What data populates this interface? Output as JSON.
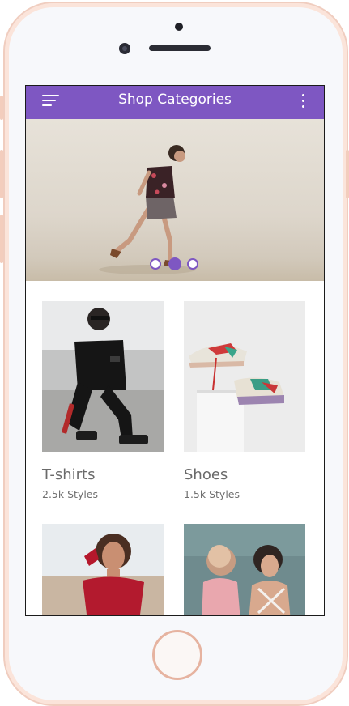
{
  "app": {
    "title": "Shop Categories",
    "accent_color": "#7e57c2",
    "menu_icon": "menu-icon",
    "more_icon": "more-vert-icon"
  },
  "carousel": {
    "slide_count": 3,
    "active_index": 1
  },
  "categories": [
    {
      "name": "T-shirts",
      "styles": "2.5k Styles"
    },
    {
      "name": "Shoes",
      "styles": "1.5k Styles"
    },
    {
      "name": "",
      "styles": ""
    },
    {
      "name": "",
      "styles": ""
    }
  ]
}
